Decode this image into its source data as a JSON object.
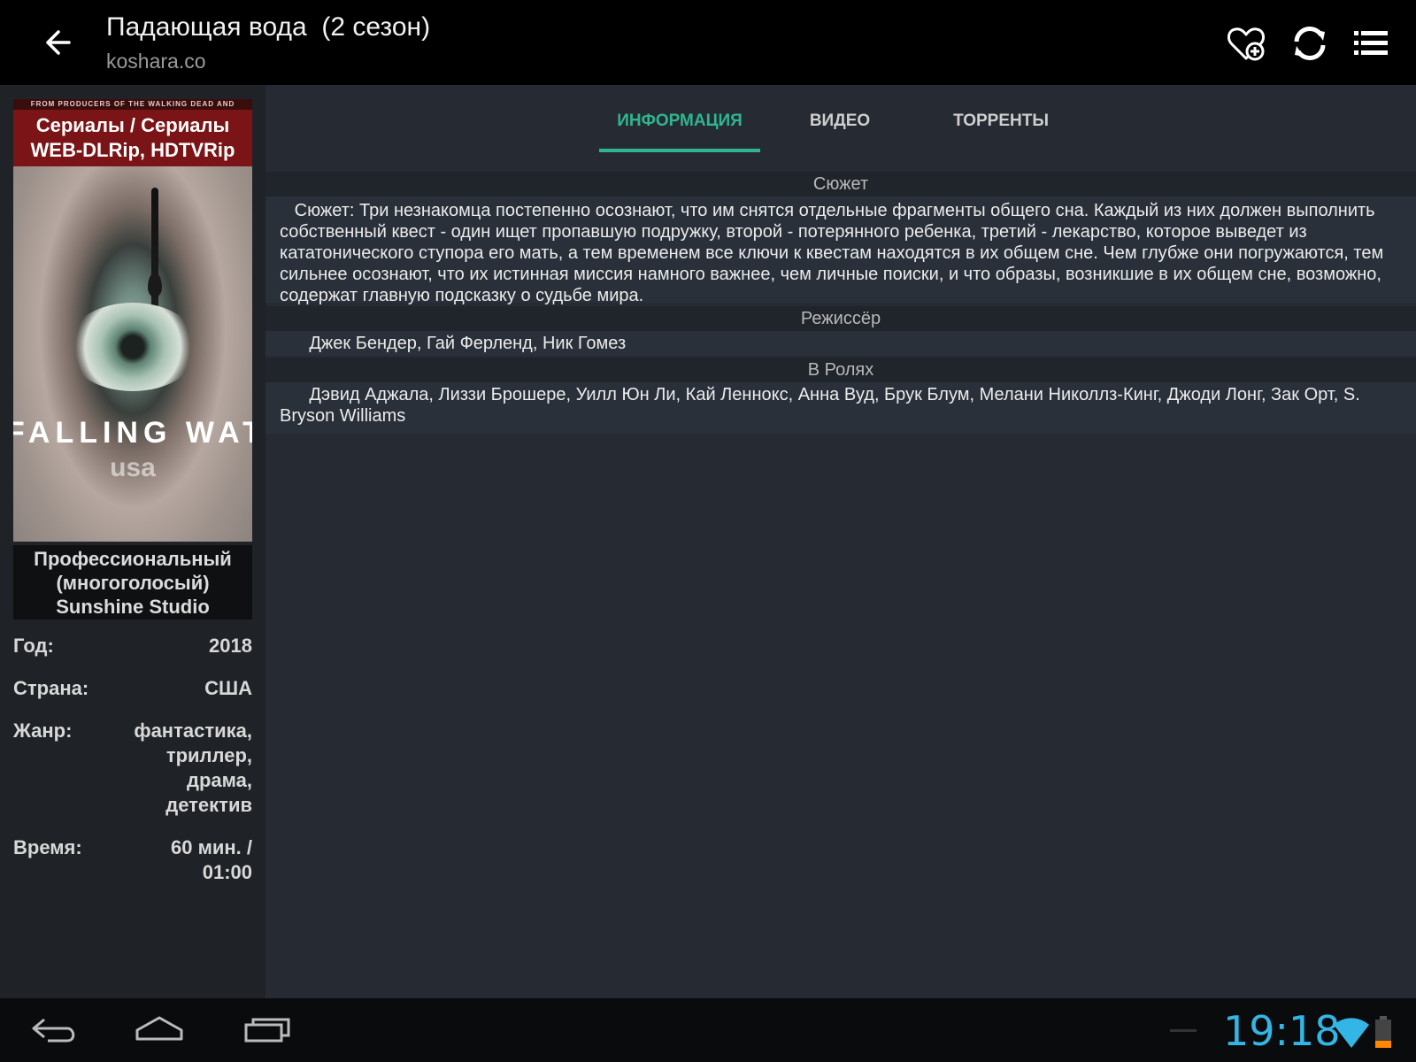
{
  "header": {
    "title": "Падающая вода  (2 сезон)",
    "subtitle": "koshara.co"
  },
  "poster": {
    "top_strip": "FROM PRODUCERS OF THE WALKING DEAD AND HOMELAND",
    "label_line1": "Сериалы / Сериалы",
    "label_line2": "WEB-DLRip, HDTVRip",
    "show_name": "FALLING WATER",
    "network": "usa",
    "translation_line1": "Профессиональный",
    "translation_line2": "(многоголосый)",
    "translation_line3": "Sunshine Studio"
  },
  "details": {
    "year_label": "Год:",
    "year_value": "2018",
    "country_label": "Страна:",
    "country_value": "США",
    "genre_label": "Жанр:",
    "genre_values": [
      "фантастика,",
      "триллер,",
      "драма,",
      "детектив"
    ],
    "time_label": "Время:",
    "time_values": [
      "60 мин. /",
      "01:00"
    ]
  },
  "tabs": {
    "info": "ИНФОРМАЦИЯ",
    "video": "ВИДЕО",
    "torrents": "ТОРРЕНТЫ"
  },
  "sections": {
    "plot_title": "Сюжет",
    "plot_text": "Сюжет: Три незнакомца постепенно осознают, что им снятся отдельные фрагменты общего сна. Каждый из них должен выполнить собственный квест - один ищет пропавшую подружку, второй - потерянного ребенка, третий - лекарство, которое выведет из кататонического ступора его мать, а тем временем все ключи к квестам находятся в их общем сне. Чем глубже они погружаются, тем сильнее осознают, что их истинная миссия намного важнее, чем личные поиски, и что образы, возникшие в их общем сне, возможно, содержат главную подсказку о судьбе мира.",
    "director_title": "Режиссёр",
    "director_text": "Джек Бендер, Гай Ферленд, Ник Гомез",
    "cast_title": "В Ролях",
    "cast_text": "Дэвид Аджала, Лиззи Брошере, Уилл Юн Ли, Кай Леннокс, Анна Вуд, Брук Блум, Мелани Николлз-Кинг, Джоди Лонг, Зак Орт, S. Bryson Williams"
  },
  "system": {
    "clock": "19:18"
  },
  "colors": {
    "accent": "#2fb58f",
    "clock": "#33b5e5",
    "battery": "#ff8800"
  },
  "icons": [
    "back-arrow-icon",
    "favorite-add-icon",
    "refresh-icon",
    "list-menu-icon",
    "nav-back-icon",
    "nav-home-icon",
    "nav-recent-icon",
    "wifi-icon",
    "battery-icon"
  ]
}
